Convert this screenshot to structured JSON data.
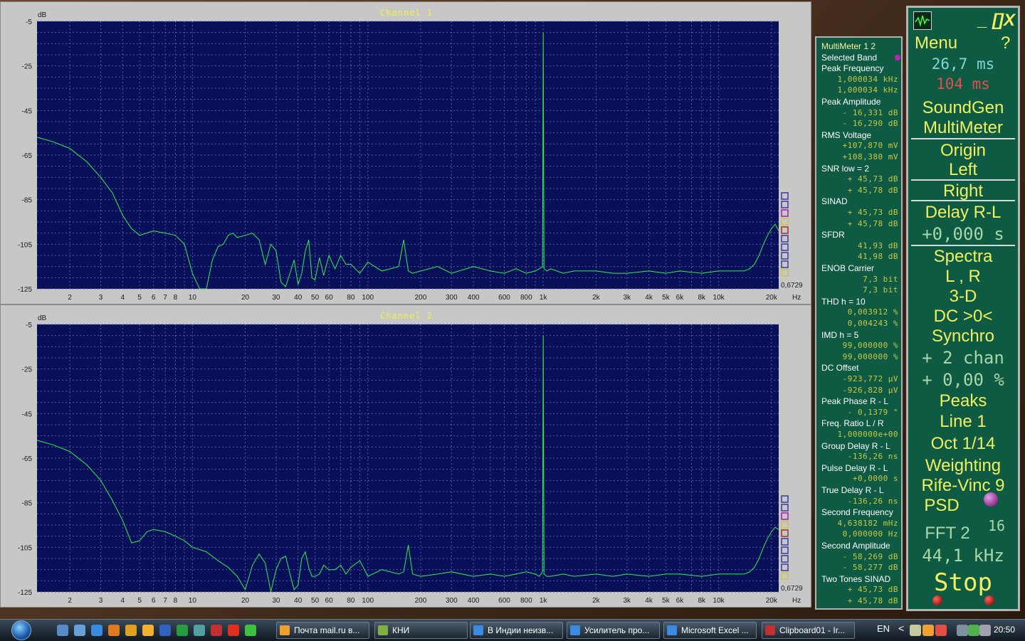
{
  "charts": [
    {
      "title": "Channel 1",
      "chart_data": {
        "type": "line",
        "title": "Channel 1",
        "ylabel": "dB",
        "xlabel": "Hz",
        "xscale": "log",
        "xlim": [
          1.3,
          22000
        ],
        "ylim": [
          -125,
          -5
        ],
        "yticks": [
          -5,
          -25,
          -45,
          -65,
          -85,
          -105,
          -125
        ],
        "xticks": [
          2,
          3,
          4,
          5,
          6,
          7,
          8,
          10,
          20,
          30,
          40,
          50,
          60,
          80,
          100,
          200,
          300,
          400,
          600,
          800,
          1000,
          2000,
          3000,
          4000,
          5000,
          6000,
          8000,
          10000,
          20000
        ],
        "xtick_labels": [
          "2",
          "3",
          "4",
          "5",
          "6",
          "7",
          "8",
          "10",
          "20",
          "30",
          "40",
          "50",
          "60",
          "80",
          "100",
          "200",
          "300",
          "400",
          "600",
          "800",
          "1k",
          "2k",
          "3k",
          "4k",
          "5k",
          "6k",
          "8k",
          "10k",
          "20k"
        ],
        "corner_label": "0,6729",
        "grid": true,
        "series": [
          {
            "x": [
              1.3,
              1.6,
              2,
              2.5,
              3,
              3.5,
              4,
              4.5,
              5,
              6,
              7,
              8,
              9,
              10,
              11,
              12,
              13,
              14,
              15,
              16,
              17,
              18,
              20,
              22,
              24,
              26,
              28,
              30,
              32,
              34,
              36,
              38,
              40,
              42,
              44,
              46,
              48,
              50,
              53,
              56,
              60,
              65,
              70,
              75,
              80,
              90,
              100,
              120,
              150,
              160,
              170,
              180,
              200,
              250,
              300,
              400,
              500,
              600,
              700,
              800,
              900,
              950,
              990,
              995,
              1000,
              1005,
              1010,
              1050,
              1100,
              1300,
              1500,
              2000,
              2500,
              3000,
              4000,
              5000,
              6000,
              8000,
              10000,
              12000,
              14000,
              15000,
              16000,
              17000,
              18000,
              19000,
              20000,
              21000,
              22000
            ],
            "y": [
              -57,
              -59,
              -62,
              -68,
              -75,
              -82,
              -92,
              -98,
              -101,
              -99,
              -100,
              -101,
              -105,
              -118,
              -126,
              -125,
              -112,
              -106,
              -105,
              -101,
              -100,
              -102,
              -101,
              -100,
              -103,
              -114,
              -105,
              -108,
              -122,
              -124,
              -118,
              -112,
              -123,
              -118,
              -108,
              -103,
              -120,
              -121,
              -111,
              -119,
              -110,
              -116,
              -110,
              -114,
              -114,
              -118,
              -113,
              -117,
              -115,
              -103,
              -117,
              -118,
              -117,
              -115,
              -118,
              -115,
              -117,
              -118,
              -116,
              -118,
              -117,
              -116,
              -115,
              -66,
              -10,
              -67,
              -116,
              -117,
              -116,
              -118,
              -117,
              -117,
              -118,
              -118,
              -117,
              -118,
              -117,
              -118,
              -117,
              -117,
              -117,
              -116,
              -114,
              -110,
              -105,
              -101,
              -98,
              -96,
              -99
            ]
          }
        ]
      }
    },
    {
      "title": "Channel 2",
      "chart_data": {
        "type": "line",
        "title": "Channel 2",
        "ylabel": "dB",
        "xlabel": "Hz",
        "xscale": "log",
        "xlim": [
          1.3,
          22000
        ],
        "ylim": [
          -125,
          -5
        ],
        "yticks": [
          -5,
          -25,
          -45,
          -65,
          -85,
          -105,
          -125
        ],
        "xticks": [
          2,
          3,
          4,
          5,
          6,
          7,
          8,
          10,
          20,
          30,
          40,
          50,
          60,
          80,
          100,
          200,
          300,
          400,
          600,
          800,
          1000,
          2000,
          3000,
          4000,
          5000,
          6000,
          8000,
          10000,
          20000
        ],
        "xtick_labels": [
          "2",
          "3",
          "4",
          "5",
          "6",
          "7",
          "8",
          "10",
          "20",
          "30",
          "40",
          "50",
          "60",
          "80",
          "100",
          "200",
          "300",
          "400",
          "600",
          "800",
          "1k",
          "2k",
          "3k",
          "4k",
          "5k",
          "6k",
          "8k",
          "10k",
          "20k"
        ],
        "corner_label": "0,6729",
        "grid": true,
        "series": [
          {
            "x": [
              1.3,
              1.6,
              2,
              2.5,
              3,
              3.5,
              4,
              4.5,
              5,
              5.5,
              6,
              7,
              8,
              9,
              10,
              11,
              12,
              14,
              16,
              18,
              20,
              22,
              24,
              26,
              28,
              30,
              32,
              34,
              36,
              38,
              40,
              42,
              44,
              46,
              48,
              50,
              53,
              56,
              60,
              65,
              70,
              75,
              80,
              90,
              100,
              120,
              150,
              160,
              170,
              180,
              200,
              250,
              300,
              400,
              500,
              600,
              700,
              800,
              900,
              950,
              990,
              995,
              1000,
              1005,
              1010,
              1050,
              1100,
              1300,
              1500,
              2000,
              2500,
              3000,
              4000,
              5000,
              6000,
              8000,
              10000,
              12000,
              14000,
              15000,
              16000,
              17000,
              18000,
              19000,
              20000,
              21000,
              22000
            ],
            "y": [
              -57,
              -59,
              -62,
              -68,
              -75,
              -84,
              -93,
              -103,
              -102,
              -98,
              -97,
              -98,
              -100,
              -102,
              -105,
              -106,
              -107,
              -111,
              -114,
              -118,
              -124,
              -113,
              -108,
              -112,
              -125,
              -115,
              -110,
              -109,
              -117,
              -124,
              -122,
              -110,
              -107,
              -114,
              -118,
              -118,
              -117,
              -113,
              -115,
              -115,
              -113,
              -117,
              -114,
              -111,
              -118,
              -115,
              -117,
              -116,
              -104,
              -117,
              -118,
              -117,
              -116,
              -118,
              -117,
              -118,
              -117,
              -116,
              -117,
              -118,
              -116,
              -65,
              -10,
              -66,
              -117,
              -118,
              -118,
              -117,
              -118,
              -117,
              -118,
              -117,
              -118,
              -117,
              -117,
              -118,
              -117,
              -117,
              -117,
              -116,
              -114,
              -110,
              -105,
              -101,
              -98,
              -96,
              -97
            ]
          }
        ]
      }
    }
  ],
  "palette": {
    "plot_bg": "#0a0f5a",
    "grid": "#4c5ea8",
    "trace": "#2cf04a",
    "title": "#f0f048",
    "labels": "#1a1a1a",
    "panel": "#0e5a42",
    "legend_colors": [
      "#3a3aa0",
      "#3a3aa0",
      "#a020a0",
      "#c8c848",
      "#a03030",
      "#3a3aa0",
      "#3a3aa0",
      "#3a3aa0",
      "#3a3aa0",
      "#c8c848"
    ]
  },
  "multimeter": {
    "rows": [
      {
        "k": "head",
        "t": "MultiMeter  1 2"
      },
      {
        "k": "lbl",
        "t": "Selected Band"
      },
      {
        "k": "lbl",
        "t": "Peak Frequency"
      },
      {
        "k": "val",
        "t": "1,000034 kHz"
      },
      {
        "k": "val",
        "t": "1,000034 kHz"
      },
      {
        "k": "lbl",
        "t": "Peak Amplitude"
      },
      {
        "k": "val",
        "t": "- 16,331 dB"
      },
      {
        "k": "val",
        "t": "- 16,290 dB"
      },
      {
        "k": "lbl",
        "t": "RMS Voltage"
      },
      {
        "k": "val",
        "t": "+107,870 mV"
      },
      {
        "k": "val",
        "t": "+108,380 mV"
      },
      {
        "k": "lbl",
        "t": "SNR    low = 2"
      },
      {
        "k": "val",
        "t": "+ 45,73 dB"
      },
      {
        "k": "val",
        "t": "+ 45,78 dB"
      },
      {
        "k": "lbl",
        "t": "SINAD"
      },
      {
        "k": "val",
        "t": "+ 45,73 dB"
      },
      {
        "k": "val",
        "t": "+ 45,78 dB"
      },
      {
        "k": "lbl",
        "t": "SFDR"
      },
      {
        "k": "val",
        "t": "41,93 dB"
      },
      {
        "k": "val",
        "t": "41,98 dB"
      },
      {
        "k": "lbl",
        "t": "ENOB    Carrier"
      },
      {
        "k": "val",
        "t": "7,3 bit"
      },
      {
        "k": "val",
        "t": "7,3 bit"
      },
      {
        "k": "lbl",
        "t": "THD     h = 10"
      },
      {
        "k": "val",
        "t": "0,003912 %"
      },
      {
        "k": "val",
        "t": "0,004243 %"
      },
      {
        "k": "lbl",
        "t": "IMD     h =   5"
      },
      {
        "k": "val",
        "t": "99,000000 %"
      },
      {
        "k": "val",
        "t": "99,000000 %"
      },
      {
        "k": "lbl",
        "t": "DC Offset"
      },
      {
        "k": "val",
        "t": "-923,772 µV"
      },
      {
        "k": "val",
        "t": "-926,828 µV"
      },
      {
        "k": "lbl",
        "t": "Peak Phase R - L"
      },
      {
        "k": "val",
        "t": "-  0,1379 °"
      },
      {
        "k": "lbl",
        "t": "Freq. Ratio  L / R"
      },
      {
        "k": "val",
        "t": "1,000000e+00"
      },
      {
        "k": "lbl",
        "t": "Group Delay R - L"
      },
      {
        "k": "val",
        "t": "-136,26 ns"
      },
      {
        "k": "lbl",
        "t": "Pulse Delay R - L"
      },
      {
        "k": "val",
        "t": "+0,0000  s"
      },
      {
        "k": "lbl",
        "t": "True  Delay R - L"
      },
      {
        "k": "val",
        "t": "-136,26 ns"
      },
      {
        "k": "lbl",
        "t": "Second Frequency"
      },
      {
        "k": "val",
        "t": "4,638182 mHz"
      },
      {
        "k": "val",
        "t": "0,000000  Hz"
      },
      {
        "k": "lbl",
        "t": "Second Amplitude"
      },
      {
        "k": "val",
        "t": "- 58,269 dB"
      },
      {
        "k": "val",
        "t": "- 58,277 dB"
      },
      {
        "k": "lbl",
        "t": "Two Tones SINAD"
      },
      {
        "k": "val",
        "t": "+ 45,73 dB"
      },
      {
        "k": "val",
        "t": "+ 45,78 dB"
      }
    ]
  },
  "menu": {
    "top_controls": "_ []X",
    "menu_label": "Menu",
    "help_label": "?",
    "time1": "26,7 ms",
    "time2": "104  ms",
    "time1_color": "#80d8d8",
    "time2_color": "#e05050",
    "items": [
      {
        "name": "soundgen",
        "t": "SoundGen"
      },
      {
        "name": "multimeter",
        "t": "MultiMeter"
      },
      {
        "name": "origin",
        "t": "Origin"
      },
      {
        "name": "left",
        "t": "Left"
      },
      {
        "name": "right",
        "t": "Right"
      },
      {
        "name": "delay-r-l",
        "t": "Delay R-L"
      },
      {
        "name": "delay-value",
        "t": "+0,000  s",
        "mono": true
      },
      {
        "name": "spectra",
        "t": "Spectra"
      },
      {
        "name": "l-r",
        "t": "L , R"
      },
      {
        "name": "3d",
        "t": "3-D"
      },
      {
        "name": "dc",
        "t": "DC  >0<"
      },
      {
        "name": "synchro",
        "t": "Synchro"
      },
      {
        "name": "chan",
        "t": "+ 2 chan",
        "mono": true
      },
      {
        "name": "percent",
        "t": "+ 0,00 %",
        "mono": true
      },
      {
        "name": "peaks",
        "t": "Peaks"
      },
      {
        "name": "line",
        "t": "Line     1"
      },
      {
        "name": "oct",
        "t": "Oct  1/14"
      },
      {
        "name": "weighting",
        "t": "Weighting"
      },
      {
        "name": "rife-vinc",
        "t": "Rife-Vinc 9"
      },
      {
        "name": "psd",
        "t": "PSD"
      },
      {
        "name": "fft",
        "t": "FFT  2"
      },
      {
        "name": "fft-exp",
        "t": "16"
      },
      {
        "name": "rate",
        "t": "44,1 kHz",
        "mono": true
      },
      {
        "name": "stop",
        "t": "Stop",
        "mono": true
      }
    ]
  },
  "taskbar": {
    "buttons": [
      "Почта mail.ru в...",
      "КНИ",
      "В Индии неизв...",
      "Усилитель про...",
      "Microsoft Excel ...",
      "Clipboard01 - Ir..."
    ],
    "lang": "EN",
    "clock": "20:50"
  }
}
